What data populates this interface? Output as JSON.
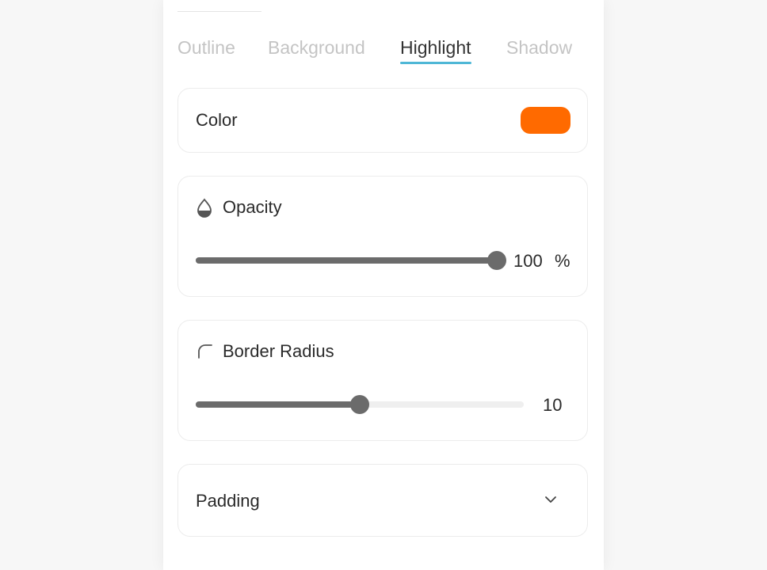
{
  "tabs": [
    {
      "label": "Outline",
      "active": false
    },
    {
      "label": "Background",
      "active": false
    },
    {
      "label": "Highlight",
      "active": true
    },
    {
      "label": "Shadow",
      "active": false
    }
  ],
  "colors": {
    "accent_underline": "#4fb7d6",
    "slider_fill": "#6b6b6b",
    "slider_track": "#efefef",
    "highlight_color": "#ff6a00"
  },
  "color_section": {
    "label": "Color",
    "value_hex": "#ff6a00"
  },
  "opacity_section": {
    "icon": "opacity-drop-icon",
    "label": "Opacity",
    "value": "100",
    "unit": "%",
    "fraction": 1.0
  },
  "radius_section": {
    "icon": "border-radius-corner-icon",
    "label": "Border Radius",
    "value": "10",
    "fraction": 0.5
  },
  "padding_section": {
    "label": "Padding",
    "icon": "chevron-down-icon"
  }
}
